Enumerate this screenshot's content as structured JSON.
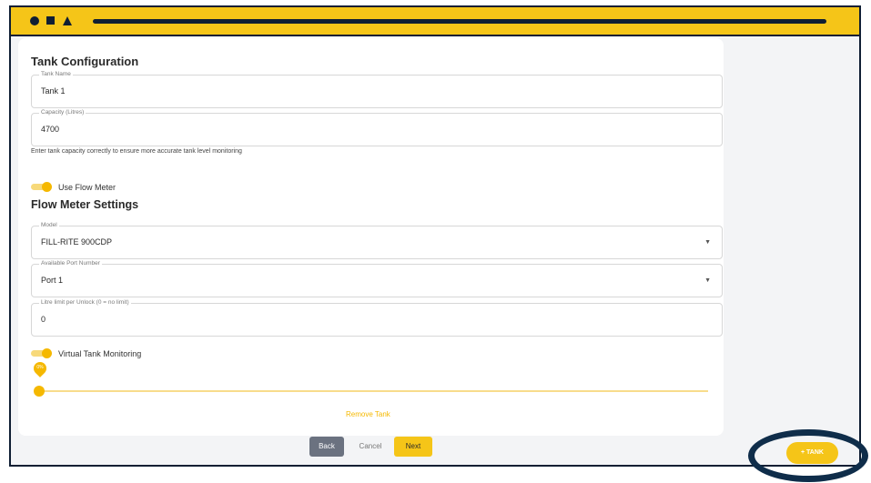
{
  "form": {
    "title": "Tank Configuration",
    "tank_name": {
      "label": "Tank Name",
      "value": "Tank 1"
    },
    "capacity": {
      "label": "Capacity (Litres)",
      "value": "4700"
    },
    "helper_text": "Enter tank capacity correctly to ensure more accurate tank level monitoring",
    "use_flow_meter": {
      "label": "Use Flow Meter",
      "on": true
    },
    "flow_meter_title": "Flow Meter Settings",
    "model": {
      "label": "Model",
      "value": "FILL-RITE 900CDP"
    },
    "port": {
      "label": "Available Port Number",
      "value": "Port 1"
    },
    "litre_limit": {
      "label": "Litre limit per Unlock (0 = no limit)",
      "value": "0"
    },
    "virtual_tank": {
      "label": "Virtual Tank Monitoring",
      "on": true
    },
    "slider": {
      "value_label": "0%",
      "value": 0
    },
    "remove_label": "Remove Tank"
  },
  "footer": {
    "back_label": "Back",
    "cancel_label": "Cancel",
    "next_label": "Next"
  },
  "fab": {
    "label": "+ TANK"
  },
  "colors": {
    "accent": "#f5c518",
    "dark": "#0f1e33"
  }
}
